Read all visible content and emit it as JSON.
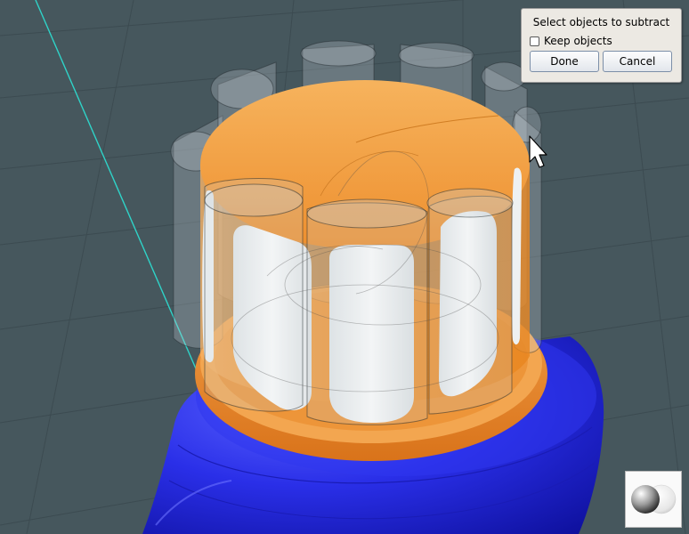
{
  "dialog": {
    "title": "Select objects to subtract",
    "keep_objects_label": "Keep objects",
    "keep_objects_checked": false,
    "done_label": "Done",
    "cancel_label": "Cancel"
  },
  "icons": {
    "cursor": "mouse-pointer-icon",
    "shading": "shading-spheres-icon"
  },
  "colors": {
    "background": "#46575d",
    "grid": "#3c4b51",
    "axis": "#2fd3c8",
    "base_object": "#2b2ee6",
    "cap_object": "#f29a3e",
    "cutter_objects": "#c8d2d6"
  }
}
